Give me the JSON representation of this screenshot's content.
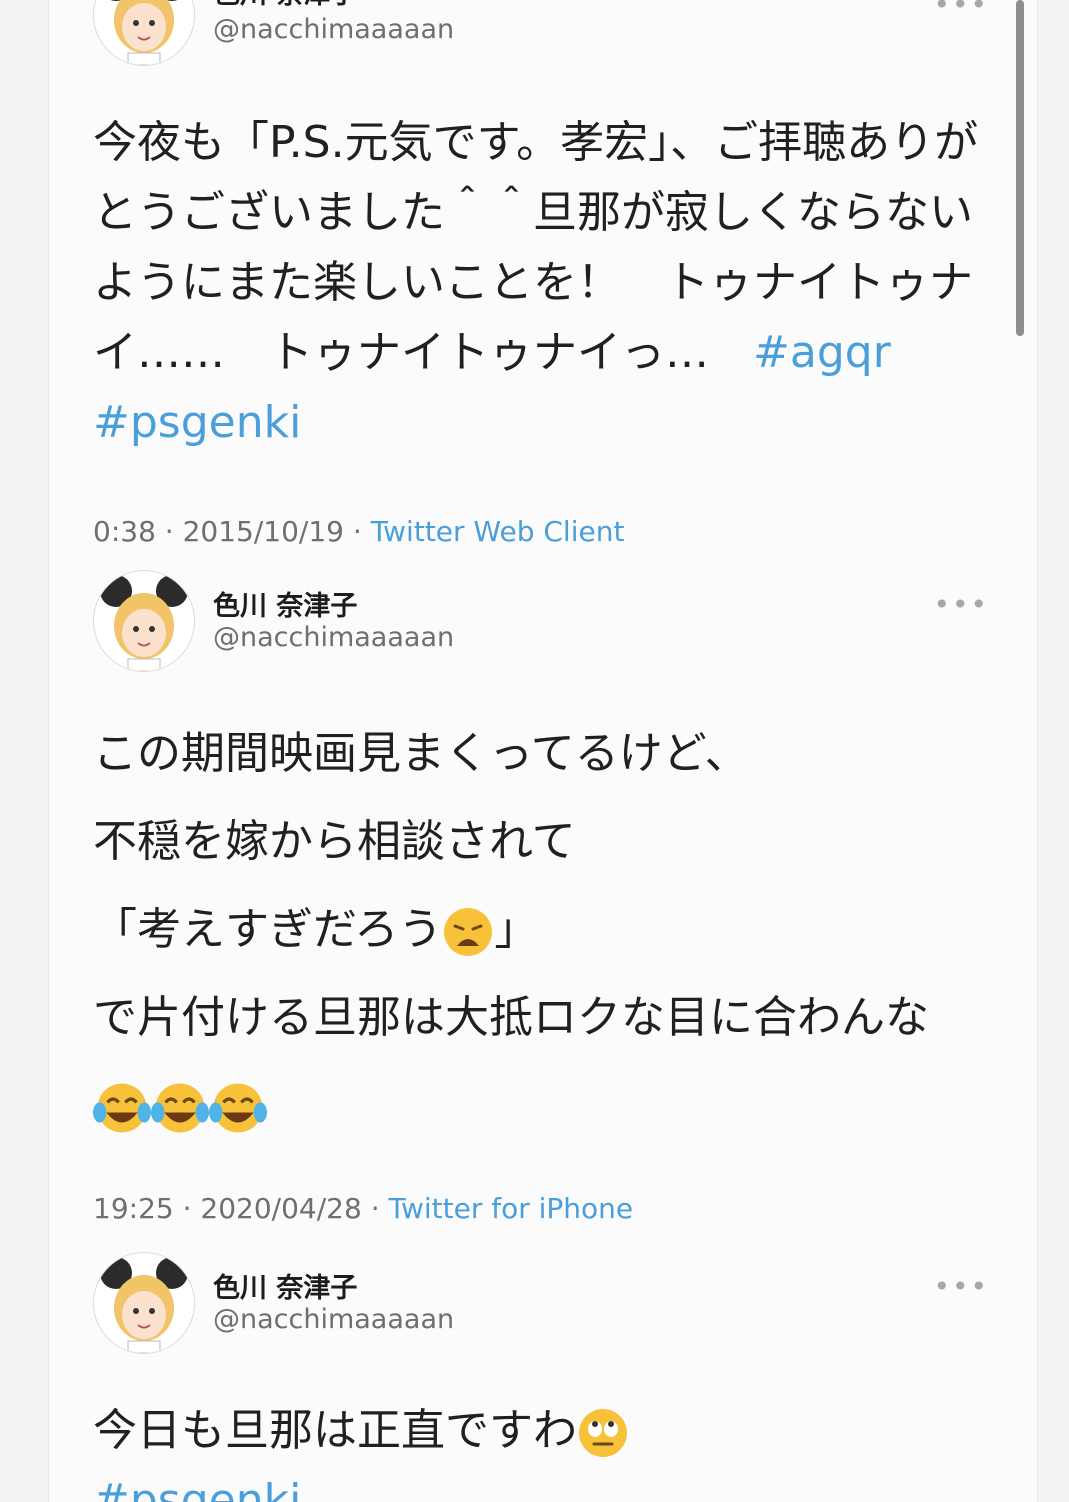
{
  "tweets": [
    {
      "name": "色川 奈津子",
      "handle": "@nacchimaaaaan",
      "text": "今夜も「P.S.元気です。孝宏」、ご拝聴ありがとうございました＾＾旦那が寂しくならないようにまた楽しいことを！　トゥナイトゥナイ……　トゥナイトゥナイっ…",
      "hashtags": [
        "#agqr",
        "#psgenki"
      ],
      "time": "0:38",
      "date": "2015/10/19",
      "client": "Twitter Web Client"
    },
    {
      "name": "色川 奈津子",
      "handle": "@nacchimaaaaan",
      "lines": [
        "この期間映画見まくってるけど、",
        "不穏を嫁から相談されて",
        "「考えすぎだろう",
        "」",
        "で片付ける旦那は大抵ロクな目に合わんな"
      ],
      "time": "19:25",
      "date": "2020/04/28",
      "client": "Twitter for iPhone"
    },
    {
      "name": "色川 奈津子",
      "handle": "@nacchimaaaaan",
      "text": "今日も旦那は正直ですわ",
      "hashtags": [
        "#psgenki"
      ]
    }
  ],
  "ui": {
    "more_label": "•••",
    "separator": " · "
  },
  "icons": [
    "avatar-icon",
    "more-icon",
    "weary-face-emoji-icon",
    "tears-of-joy-emoji-icon",
    "eye-roll-emoji-icon"
  ],
  "colors": {
    "link": "#4a9fdb",
    "handle": "#6e6e73",
    "text": "#202020"
  }
}
